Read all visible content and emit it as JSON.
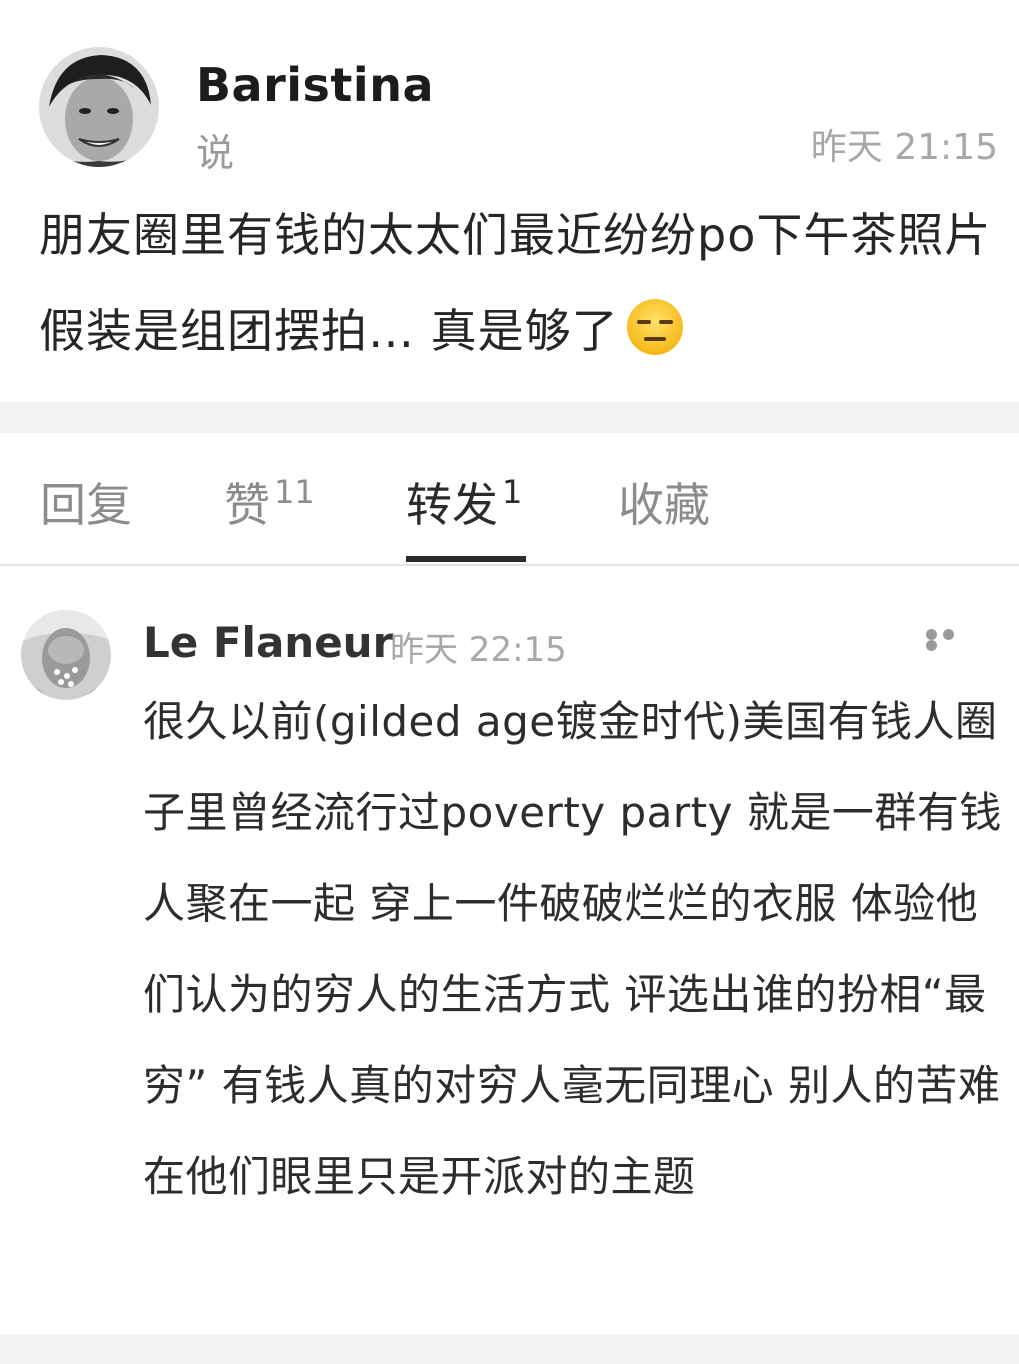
{
  "post": {
    "author": "Baristina",
    "say_label": "说",
    "time": "昨天 21:15",
    "text": "朋友圈里有钱的太太们最近纷纷po下午茶照片假装是组团摆拍… 真是够了",
    "emoji": "expressionless-face-icon"
  },
  "tabs": {
    "reply": {
      "label": "回复"
    },
    "like": {
      "label": "赞",
      "count": "11"
    },
    "repost": {
      "label": "转发",
      "count": "1"
    },
    "favorite": {
      "label": "收藏"
    }
  },
  "comment": {
    "author": "Le Flaneur",
    "time": "昨天 22:15",
    "text": "很久以前(gilded age镀金时代)美国有钱人圈子里曾经流行过poverty party 就是一群有钱人聚在一起 穿上一件破破烂烂的衣服 体验他们认为的穷人的生活方式 评选出谁的扮相“最穷” 有钱人真的对穷人毫无同理心 别人的苦难在他们眼里只是开派对的主题"
  },
  "colors": {
    "separator": "#f2f2f2",
    "active_tab": "#2b2b2b",
    "muted_text": "#a8a8a8"
  }
}
